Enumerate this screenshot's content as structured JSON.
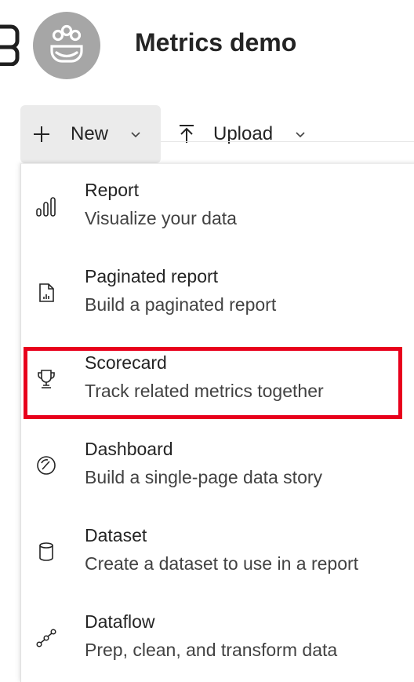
{
  "header": {
    "workspace_title": "Metrics demo"
  },
  "toolbar": {
    "new_label": "New",
    "upload_label": "Upload"
  },
  "menu": {
    "items": [
      {
        "title": "Report",
        "description": "Visualize your data",
        "icon": "bar-chart-icon"
      },
      {
        "title": "Paginated report",
        "description": "Build a paginated report",
        "icon": "paginated-report-icon"
      },
      {
        "title": "Scorecard",
        "description": "Track related metrics together",
        "icon": "trophy-icon"
      },
      {
        "title": "Dashboard",
        "description": "Build a single-page data story",
        "icon": "gauge-icon"
      },
      {
        "title": "Dataset",
        "description": "Create a dataset to use in a report",
        "icon": "database-icon"
      },
      {
        "title": "Dataflow",
        "description": "Prep, clean, and transform data",
        "icon": "dataflow-icon"
      }
    ],
    "highlighted_item": "Scorecard"
  },
  "colors": {
    "highlight": "#e8001c",
    "avatar": "#a6a6a6",
    "button_bg": "#ebebeb"
  }
}
